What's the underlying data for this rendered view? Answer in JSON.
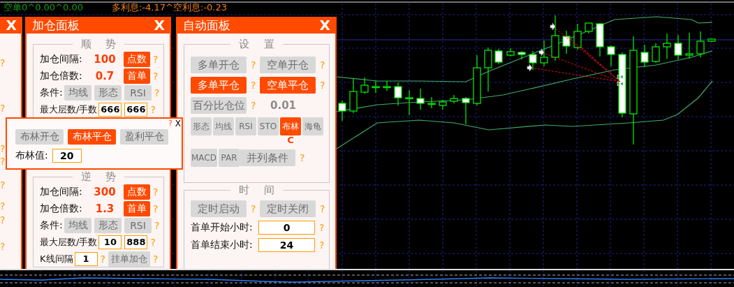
{
  "status_bar": {
    "position_summary": "空单0^0.00^0.00",
    "interest": "多利息:-4.17^空利息:-0.23"
  },
  "side_panel": {
    "close": "X",
    "help_marks": [
      "?",
      "?",
      "?",
      "?",
      "?",
      "?",
      "?",
      "?"
    ]
  },
  "add_panel": {
    "title": "加仓面板",
    "close": "X",
    "groups": [
      {
        "title": "顺 势",
        "rows": [
          {
            "kind": "value",
            "label": "加仓间隔:",
            "value": "100",
            "button": {
              "label": "点数",
              "on": true
            },
            "help": "?"
          },
          {
            "kind": "value",
            "label": "加仓倍数:",
            "value": "0.7",
            "button": {
              "label": "首单",
              "on": true
            },
            "help": "?"
          },
          {
            "kind": "conditions",
            "label": "条件:",
            "buttons": [
              {
                "label": "均线",
                "on": false
              },
              {
                "label": "形态",
                "on": false
              },
              {
                "label": "RSI",
                "on": false
              }
            ],
            "help": "?"
          },
          {
            "kind": "limits",
            "label": "最大层数/手数",
            "fields": [
              "666",
              "666"
            ],
            "help": "?"
          }
        ]
      },
      {
        "title": "逆 势",
        "rows": [
          {
            "kind": "value",
            "label": "加仓间隔:",
            "value": "300",
            "button": {
              "label": "点数",
              "on": true
            },
            "help": "?"
          },
          {
            "kind": "value",
            "label": "加仓倍数:",
            "value": "1.3",
            "button": {
              "label": "首单",
              "on": true
            },
            "help": "?"
          },
          {
            "kind": "conditions",
            "label": "条件:",
            "buttons": [
              {
                "label": "均线",
                "on": false
              },
              {
                "label": "形态",
                "on": false
              },
              {
                "label": "RSI",
                "on": false
              }
            ],
            "help": "?"
          },
          {
            "kind": "limits",
            "label": "最大层数/手数",
            "fields": [
              "10",
              "888"
            ],
            "help": "?"
          },
          {
            "kind": "interval",
            "label": "K线间隔",
            "field": "1",
            "help": "?",
            "button": {
              "label": "挂单加仓",
              "on": false
            },
            "help_2": "?"
          }
        ]
      }
    ]
  },
  "bollinger_popup": {
    "help": "?",
    "close": "X",
    "buttons": [
      {
        "label": "布林开仓",
        "on": false
      },
      {
        "label": "布林平仓",
        "on": true
      },
      {
        "label": "盈利平仓",
        "on": false
      }
    ],
    "field": {
      "label": "布林值:",
      "value": "20"
    }
  },
  "auto_panel": {
    "title": "自动面板",
    "close": "X",
    "groups": [
      {
        "title": "设 置",
        "rows": [
          {
            "kind": "pair",
            "buttons": [
              {
                "label": "多单开仓",
                "on": false,
                "help": "?"
              },
              {
                "label": "空单开仓",
                "on": false,
                "help": "?"
              }
            ]
          },
          {
            "kind": "pair",
            "buttons": [
              {
                "label": "多单平仓",
                "on": true,
                "help": "?"
              },
              {
                "label": "空单平仓",
                "on": true,
                "help": "?"
              }
            ]
          },
          {
            "kind": "percent",
            "button": {
              "label": "百分比仓位",
              "on": false
            },
            "help": "?",
            "value": "0.01"
          },
          {
            "kind": "filters",
            "buttons": [
              {
                "label": "形态",
                "on": false
              },
              {
                "label": "均线",
                "on": false
              },
              {
                "label": "RSI",
                "on": false
              },
              {
                "label": "STO",
                "on": false
              },
              {
                "label": "布林",
                "on": true,
                "mode": "C"
              },
              {
                "label": "海龟",
                "on": false
              }
            ]
          },
          {
            "kind": "filters",
            "buttons": [
              {
                "label": "MACD",
                "on": false
              },
              {
                "label": "PAR",
                "on": false
              }
            ],
            "extra": {
              "label": "并列条件",
              "on": false,
              "help": "?"
            }
          }
        ]
      },
      {
        "title": "时 间",
        "rows": [
          {
            "kind": "pair",
            "buttons": [
              {
                "label": "定时启动",
                "on": false,
                "help": "?"
              },
              {
                "label": "定时关闭",
                "on": false,
                "help": "?"
              }
            ]
          },
          {
            "kind": "field",
            "label": "首单开始小时:",
            "value": "0",
            "help": "?"
          },
          {
            "kind": "field",
            "label": "首单结束小时:",
            "value": "24",
            "help": "?"
          }
        ]
      }
    ]
  }
}
